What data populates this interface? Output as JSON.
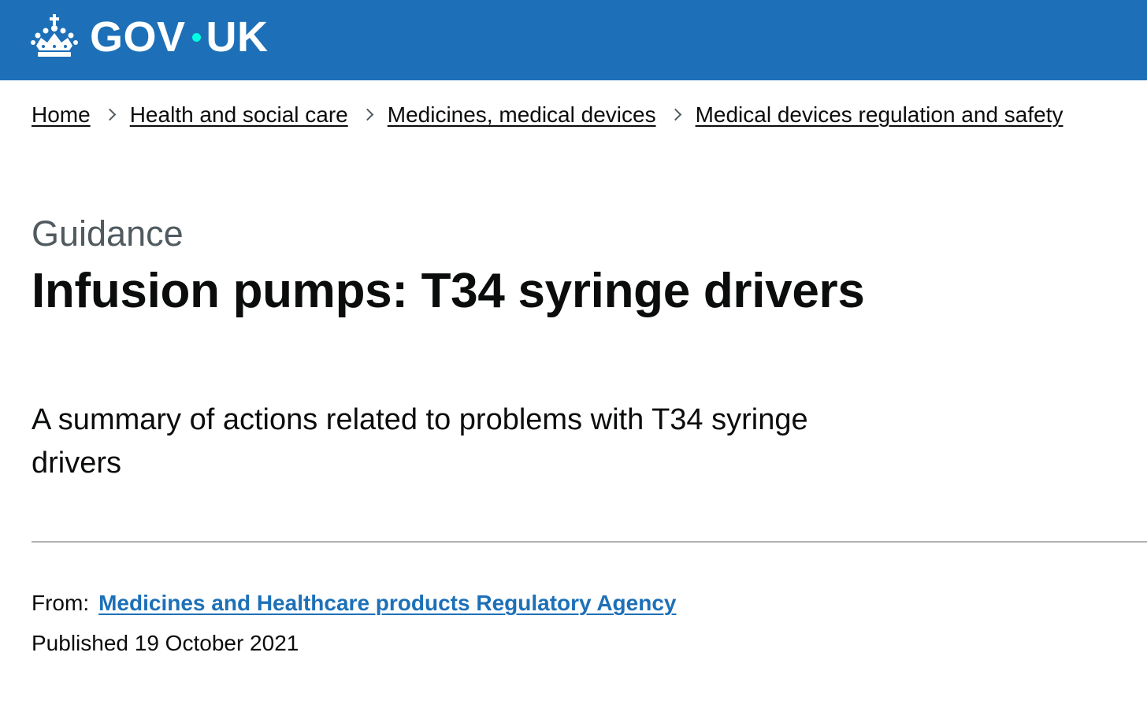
{
  "header": {
    "logo_text_left": "GOV",
    "logo_text_right": "UK",
    "logo_icon": "crown-icon",
    "background_color": "#1d70b8",
    "dot_color": "#00ffe0"
  },
  "breadcrumbs": [
    {
      "label": "Home"
    },
    {
      "label": "Health and social care"
    },
    {
      "label": "Medicines, medical devices"
    },
    {
      "label": "Medical devices regulation and safety"
    }
  ],
  "breadcrumb_separator_icon": "chevron-right-icon",
  "page": {
    "caption": "Guidance",
    "title": "Infusion pumps: T34 syringe drivers",
    "lead_line1": "A summary of actions related to problems with T34 syringe",
    "lead_line2": "drivers"
  },
  "metadata": {
    "from_label": "From:",
    "organisation": "Medicines and Healthcare products Regulatory Agency",
    "published": "Published 19 October 2021",
    "link_color": "#1d70b8"
  }
}
